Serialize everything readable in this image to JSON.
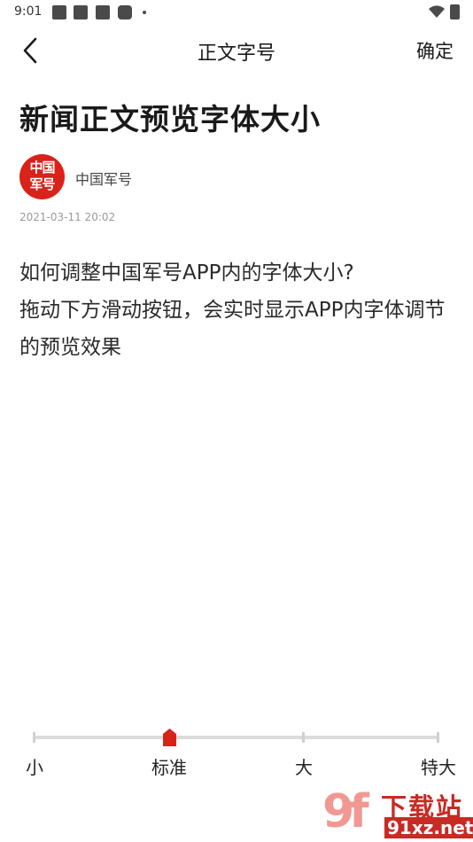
{
  "status_bar": {
    "time": "9:01",
    "icons": [
      "notification-icon",
      "notification-icon",
      "notification-icon",
      "notification-icon",
      "more-dot-icon",
      "wifi-icon",
      "battery-icon"
    ]
  },
  "nav": {
    "back_icon": "chevron-left-icon",
    "title": "正文字号",
    "confirm_label": "确定"
  },
  "article": {
    "headline": "新闻正文预览字体大小",
    "source_logo_text": "中国军号",
    "source_name": "中国军号",
    "date": "2021-03-11 20:02",
    "paragraphs": [
      "如何调整中国军号APP内的字体大小?",
      "拖动下方滑动按钮，会实时显示APP内字体调节的预览效果"
    ]
  },
  "font_size_slider": {
    "options": [
      "小",
      "标准",
      "大",
      "特大"
    ],
    "selected_index": 1,
    "selected_label": "标准",
    "accent_color": "#d8221a"
  },
  "watermark": {
    "mark": "9f",
    "text": "下载站",
    "url": "91xz.net"
  },
  "colors": {
    "accent": "#d8221a",
    "track": "#dcdcdc",
    "text": "#1f1f1f",
    "muted": "#9a9a9a"
  }
}
